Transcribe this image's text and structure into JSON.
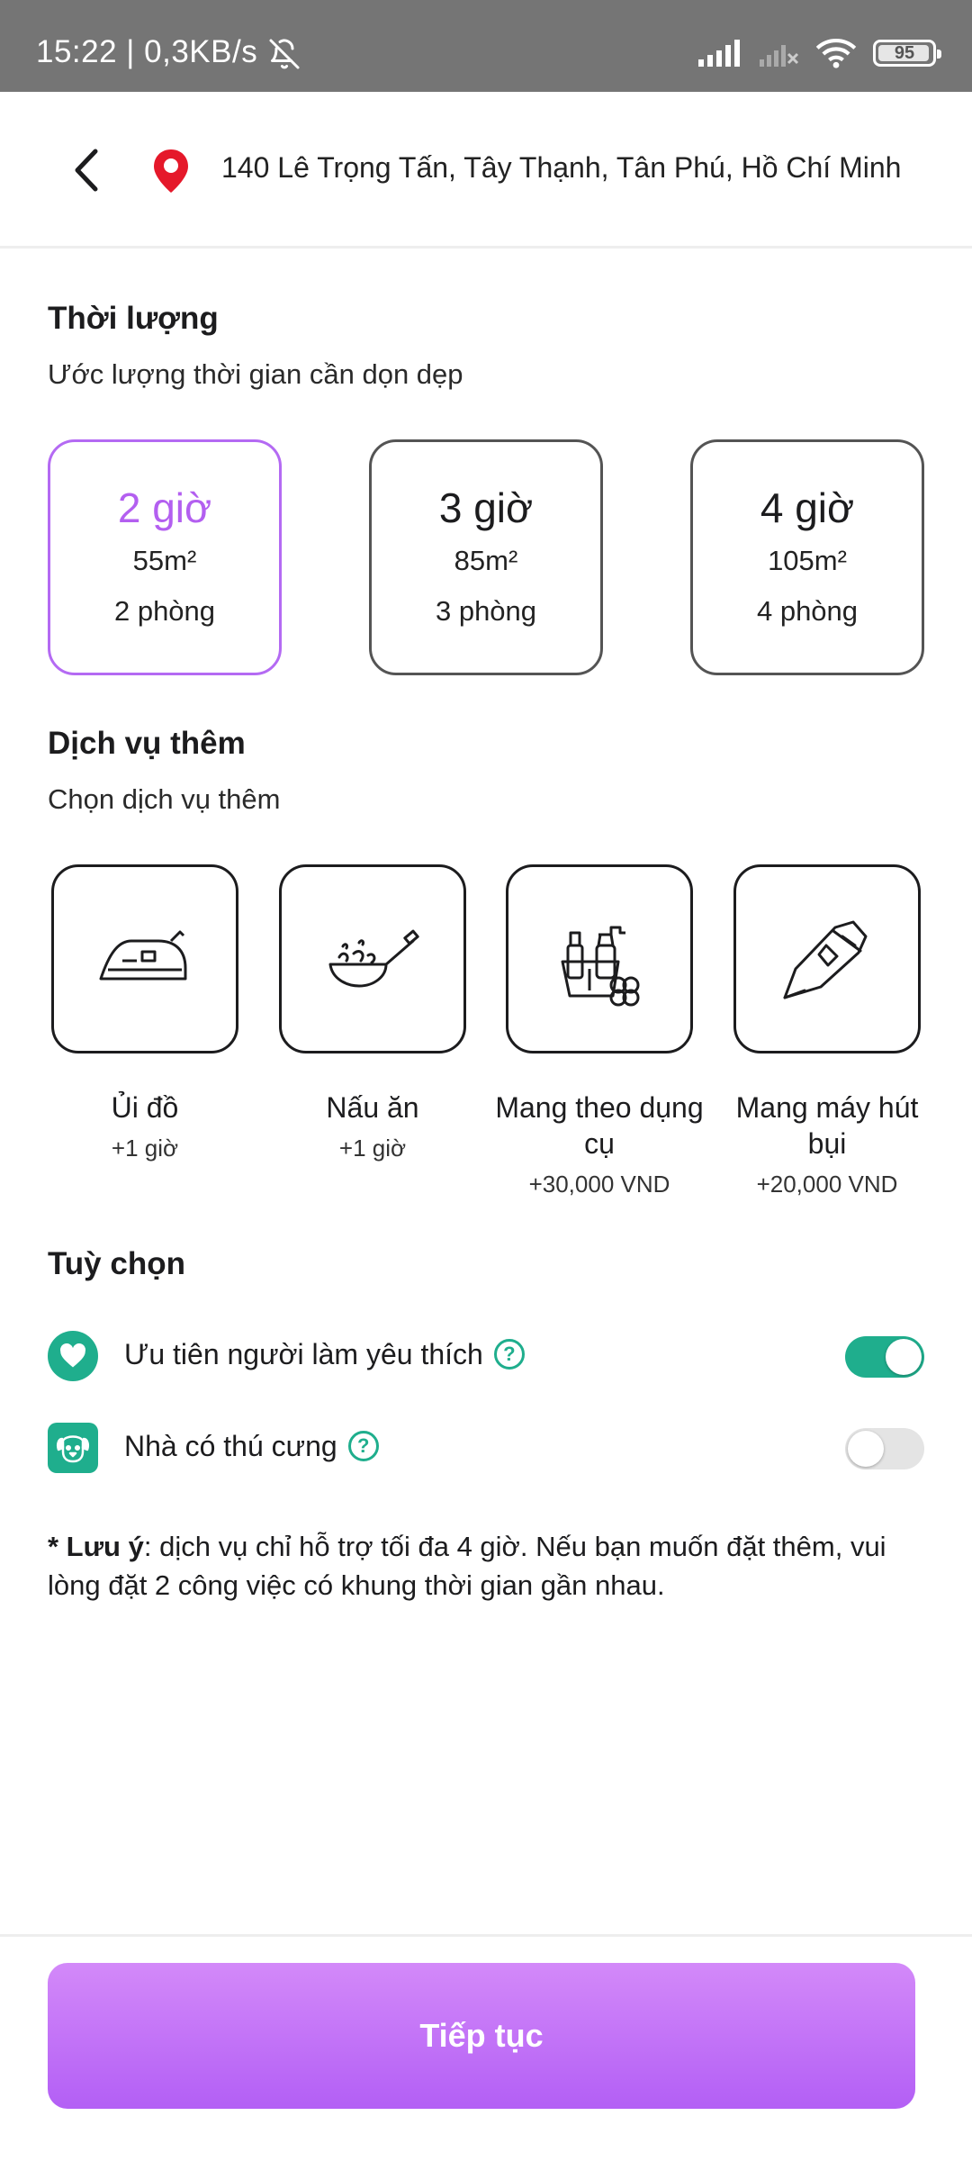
{
  "status_bar": {
    "time": "15:22 | 0,3KB/s",
    "battery": "95"
  },
  "header": {
    "address": "140 Lê Trọng Tấn, Tây Thạnh, Tân Phú, Hồ Chí Minh"
  },
  "duration": {
    "title": "Thời lượng",
    "subtitle": "Ước lượng thời gian cần dọn dẹp",
    "options": [
      {
        "hours": "2 giờ",
        "area": "55m²",
        "rooms": "2 phòng",
        "selected": true
      },
      {
        "hours": "3 giờ",
        "area": "85m²",
        "rooms": "3 phòng",
        "selected": false
      },
      {
        "hours": "4 giờ",
        "area": "105m²",
        "rooms": "4 phòng",
        "selected": false
      }
    ]
  },
  "extras": {
    "title": "Dịch vụ thêm",
    "subtitle": "Chọn dịch vụ thêm",
    "items": [
      {
        "icon": "iron-icon",
        "name": "Ủi đồ",
        "price": "+1 giờ"
      },
      {
        "icon": "wok-icon",
        "name": "Nấu ăn",
        "price": "+1 giờ"
      },
      {
        "icon": "cleaning-tools-icon",
        "name": "Mang theo dụng cụ",
        "price": "+30,000 VND"
      },
      {
        "icon": "vacuum-icon",
        "name": "Mang máy hút bụi",
        "price": "+20,000 VND"
      }
    ]
  },
  "options": {
    "title": "Tuỳ chọn",
    "items": [
      {
        "icon": "heart-icon",
        "label": "Ưu tiên người làm yêu thích",
        "enabled": true
      },
      {
        "icon": "pet-icon",
        "label": "Nhà có thú cưng",
        "enabled": false
      }
    ]
  },
  "note": {
    "label": "* Lưu ý",
    "text": ": dịch vụ chỉ hỗ trợ tối đa 4 giờ. Nếu bạn muốn đặt thêm, vui lòng đặt 2 công việc có khung thời gian gần nhau."
  },
  "continue_label": "Tiếp tục",
  "colors": {
    "accent_purple": "#b35ff0",
    "accent_green": "#1fae8d"
  }
}
